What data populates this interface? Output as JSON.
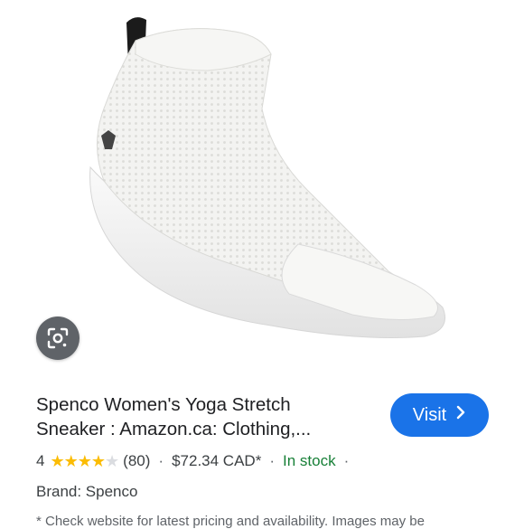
{
  "product": {
    "title_line1": "Spenco Women's Yoga Stretch",
    "title_line2": "Sneaker : Amazon.ca: Clothing,...",
    "rating": "4",
    "rating_value": 4,
    "stars_total": 5,
    "review_count": "(80)",
    "price": "$72.34 CAD*",
    "separator": "·",
    "stock": "In stock",
    "brand": "Brand: Spenco"
  },
  "visit_button": {
    "label": "Visit",
    "icon": "chevron-right-icon"
  },
  "lens_button": {
    "icon": "google-lens-icon"
  },
  "footnote": "* Check website for latest pricing and availability. Images may be",
  "colors": {
    "accent": "#1a73e8",
    "star": "#fbbc04",
    "in_stock": "#188038",
    "lens_bg": "#5f6368"
  }
}
